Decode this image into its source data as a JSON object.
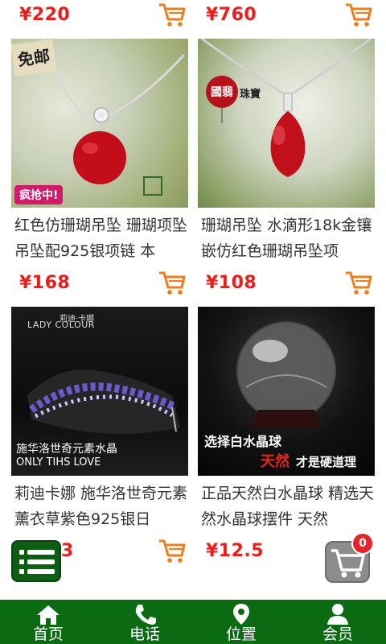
{
  "products": [
    {
      "price": "¥220",
      "title": ""
    },
    {
      "price": "¥760",
      "title": ""
    },
    {
      "price": "¥168",
      "title": "红色仿珊瑚吊坠 珊瑚项坠吊坠配925银项链 本",
      "badge_top": "免邮",
      "badge_bottom": "疯抢中!"
    },
    {
      "price": "¥108",
      "title": "珊瑚吊坠 水滴形18k金镶嵌仿红色珊瑚吊坠项",
      "badge_top": "國翡",
      "badge_sub": "珠寶"
    },
    {
      "price": "",
      "title": "莉迪卡娜 施华洛世奇元素薰衣草紫色925银日",
      "brand_line1": "莉迪·卡娜",
      "brand_line2": "LADY COLOUR",
      "caption1": "施华洛世奇元素水晶",
      "caption2": "ONLY TIHS LOVE"
    },
    {
      "price": "¥12.5",
      "title": "正品天然白水晶球 精选天然水晶球摆件 天然",
      "caption1": "选择白水晶球",
      "caption2a": "天然",
      "caption2b": "才是硬道理"
    }
  ],
  "partial_price": "3",
  "cart_badge_count": "0",
  "nav": [
    {
      "label": "首页",
      "icon": "home-icon"
    },
    {
      "label": "电话",
      "icon": "phone-icon"
    },
    {
      "label": "位置",
      "icon": "location-icon"
    },
    {
      "label": "会员",
      "icon": "member-icon"
    }
  ],
  "colors": {
    "nav_bg": "#0a6b13",
    "price": "#f21b1b",
    "cart": "#f07d1a"
  }
}
